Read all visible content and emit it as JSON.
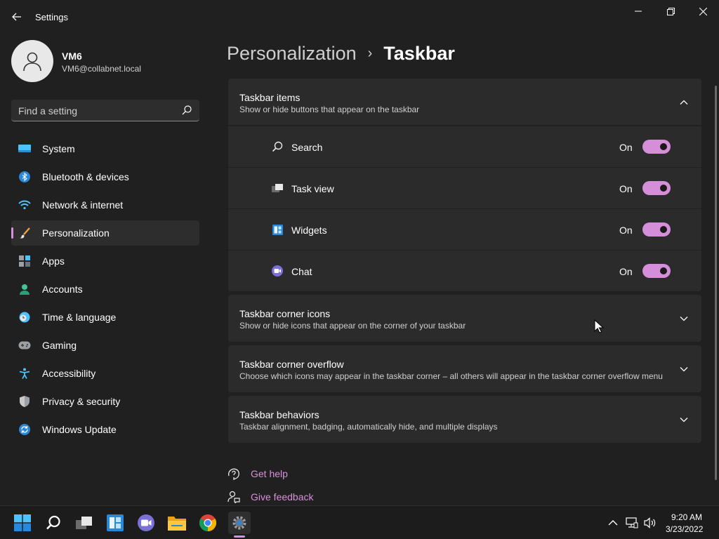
{
  "window": {
    "title": "Settings"
  },
  "user": {
    "name": "VM6",
    "email": "VM6@collabnet.local"
  },
  "search": {
    "placeholder": "Find a setting"
  },
  "sidebar": {
    "items": [
      {
        "label": "System",
        "icon": "monitor-icon"
      },
      {
        "label": "Bluetooth & devices",
        "icon": "bluetooth-icon"
      },
      {
        "label": "Network & internet",
        "icon": "wifi-icon"
      },
      {
        "label": "Personalization",
        "icon": "brush-icon",
        "active": true
      },
      {
        "label": "Apps",
        "icon": "apps-icon"
      },
      {
        "label": "Accounts",
        "icon": "person-icon"
      },
      {
        "label": "Time & language",
        "icon": "globe-clock-icon"
      },
      {
        "label": "Gaming",
        "icon": "gamepad-icon"
      },
      {
        "label": "Accessibility",
        "icon": "accessibility-icon"
      },
      {
        "label": "Privacy & security",
        "icon": "shield-icon"
      },
      {
        "label": "Windows Update",
        "icon": "update-icon"
      }
    ]
  },
  "header": {
    "parent": "Personalization",
    "separator": "›",
    "current": "Taskbar"
  },
  "sections": {
    "items": {
      "title": "Taskbar items",
      "subtitle": "Show or hide buttons that appear on the taskbar",
      "expanded": true,
      "rows": [
        {
          "label": "Search",
          "state": "On",
          "icon": "search-icon"
        },
        {
          "label": "Task view",
          "state": "On",
          "icon": "task-view-icon"
        },
        {
          "label": "Widgets",
          "state": "On",
          "icon": "widgets-icon"
        },
        {
          "label": "Chat",
          "state": "On",
          "icon": "chat-icon"
        }
      ]
    },
    "corner_icons": {
      "title": "Taskbar corner icons",
      "subtitle": "Show or hide icons that appear on the corner of your taskbar"
    },
    "corner_overflow": {
      "title": "Taskbar corner overflow",
      "subtitle": "Choose which icons may appear in the taskbar corner – all others will appear in the taskbar corner overflow menu"
    },
    "behaviors": {
      "title": "Taskbar behaviors",
      "subtitle": "Taskbar alignment, badging, automatically hide, and multiple displays"
    }
  },
  "links": {
    "help": "Get help",
    "feedback": "Give feedback"
  },
  "colors": {
    "accent": "#d98fd9",
    "toggle_on": "#d58fd8",
    "background": "#202020",
    "card": "#2b2b2b"
  },
  "taskbar": {
    "apps": [
      "start-icon",
      "search-icon",
      "task-view-icon",
      "widgets-icon",
      "chat-icon",
      "file-explorer-icon",
      "chrome-icon",
      "settings-icon"
    ],
    "time": "9:20 AM",
    "date": "3/23/2022"
  }
}
